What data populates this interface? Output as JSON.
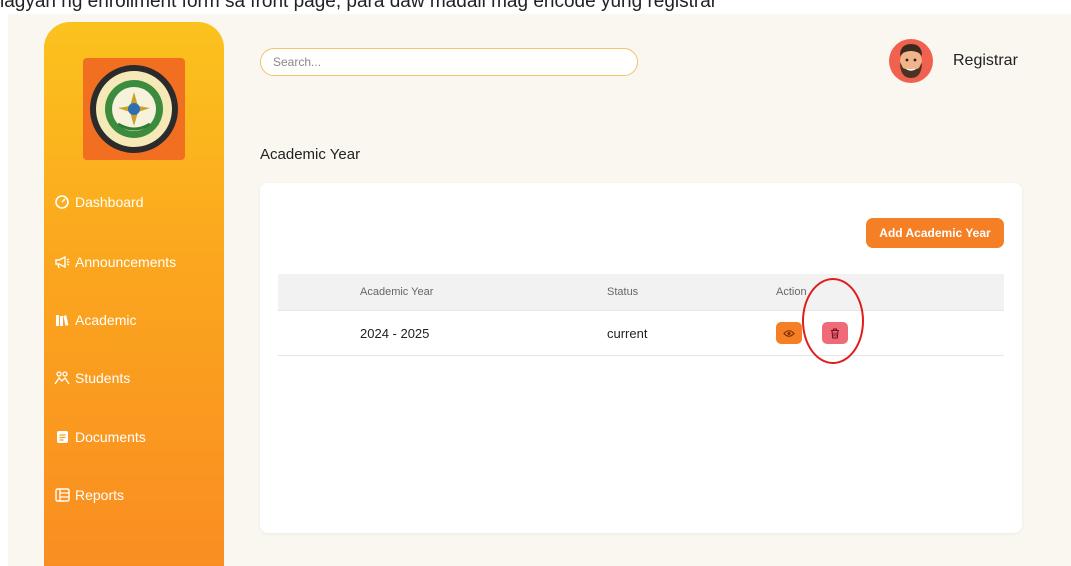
{
  "caption": "lagyan ng enrollment form sa front page, para daw madali mag encode yung registrar",
  "sidebar": {
    "items": [
      {
        "label": "Dashboard",
        "icon": "dashboard-icon"
      },
      {
        "label": "Announcements",
        "icon": "megaphone-icon"
      },
      {
        "label": "Academic",
        "icon": "books-icon"
      },
      {
        "label": "Students",
        "icon": "students-icon"
      },
      {
        "label": "Documents",
        "icon": "document-icon"
      },
      {
        "label": "Reports",
        "icon": "reports-icon"
      }
    ]
  },
  "header": {
    "search_placeholder": "Search...",
    "user_name": "Registrar"
  },
  "main": {
    "page_title": "Academic Year",
    "add_button_label": "Add Academic Year",
    "table": {
      "columns": [
        "Academic Year",
        "Status",
        "Action"
      ],
      "rows": [
        {
          "academic_year": "2024 - 2025",
          "status": "current"
        }
      ]
    }
  },
  "colors": {
    "sidebar_top": "#fbc21d",
    "sidebar_bottom": "#f98c22",
    "accent": "#f47f24",
    "delete": "#f06b7a",
    "annotation": "#e21b1b"
  }
}
